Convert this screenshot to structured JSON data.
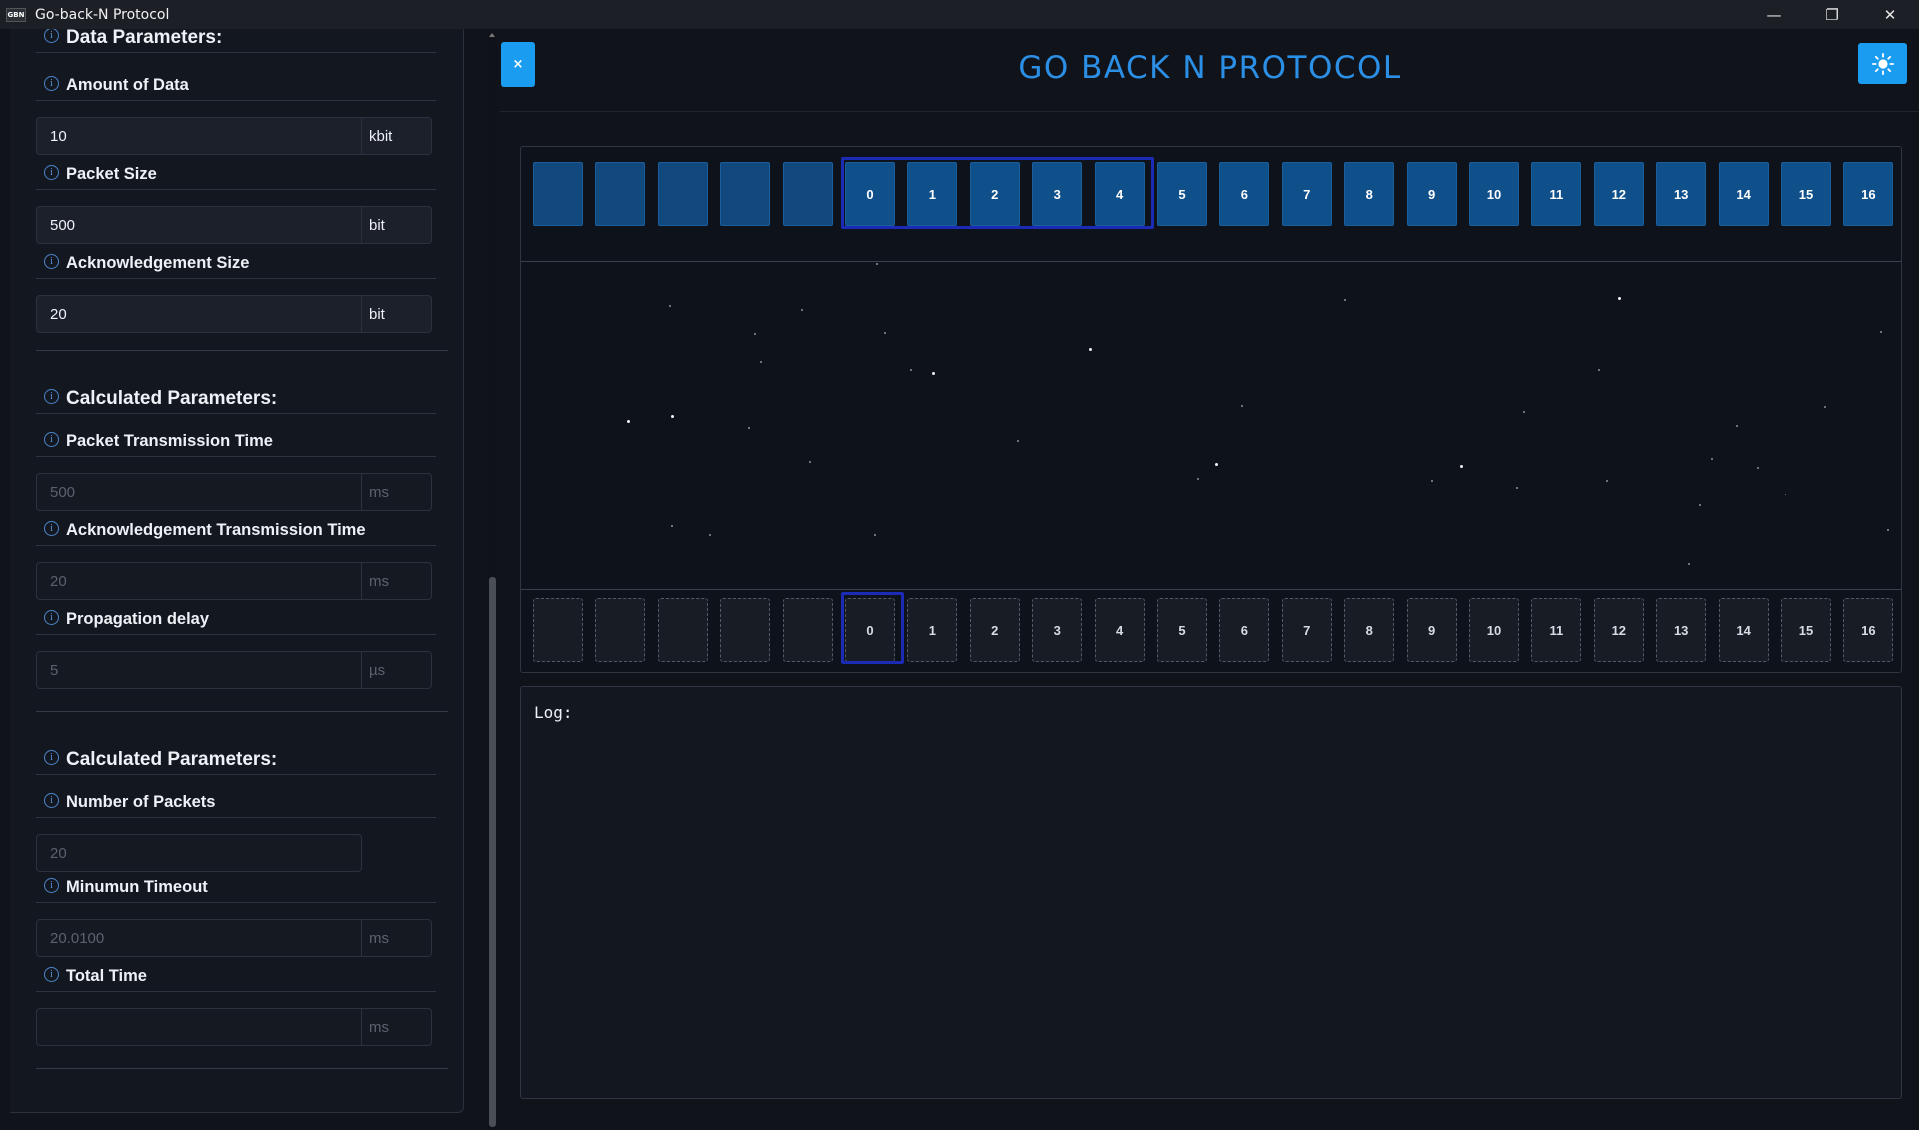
{
  "window": {
    "icon_text": "GBN",
    "title": "Go-back-N Protocol",
    "minimize": "—",
    "restore": "❐",
    "close": "✕"
  },
  "sidebar": {
    "data_params": {
      "heading": "Data Parameters:",
      "amount_label": "Amount of Data",
      "amount_value": "10",
      "amount_unit": "kbit",
      "packet_size_label": "Packet Size",
      "packet_size_value": "500",
      "packet_size_unit": "bit",
      "ack_size_label": "Acknowledgement Size",
      "ack_size_value": "20",
      "ack_size_unit": "bit"
    },
    "calc1": {
      "heading": "Calculated Parameters:",
      "ptt_label": "Packet Transmission Time",
      "ptt_value": "500",
      "ptt_unit": "ms",
      "att_label": "Acknowledgement Transmission Time",
      "att_value": "20",
      "att_unit": "ms",
      "prop_label": "Propagation delay",
      "prop_value": "5",
      "prop_unit": "µs"
    },
    "calc2": {
      "heading": "Calculated Parameters:",
      "num_packets_label": "Number of Packets",
      "num_packets_value": "20",
      "timeout_label": "Minumun Timeout",
      "timeout_value": "20.0100",
      "timeout_unit": "ms",
      "total_label": "Total Time",
      "total_value": "",
      "total_unit": "ms"
    }
  },
  "main": {
    "close_button": "×",
    "title": "GO BACK N PROTOCOL",
    "sender_packets": [
      "",
      "",
      "",
      "",
      "",
      "0",
      "1",
      "2",
      "3",
      "4",
      "5",
      "6",
      "7",
      "8",
      "9",
      "10",
      "11",
      "12",
      "13",
      "14",
      "15",
      "16"
    ],
    "receiver_packets": [
      "",
      "",
      "",
      "",
      "",
      "0",
      "1",
      "2",
      "3",
      "4",
      "5",
      "6",
      "7",
      "8",
      "9",
      "10",
      "11",
      "12",
      "13",
      "14",
      "15",
      "16"
    ],
    "log_label": "Log:"
  },
  "colors": {
    "accent": "#1a9cf0",
    "title": "#2b8fe6",
    "packet": "#0f4f8a",
    "window_border": "#1b2bb5"
  }
}
